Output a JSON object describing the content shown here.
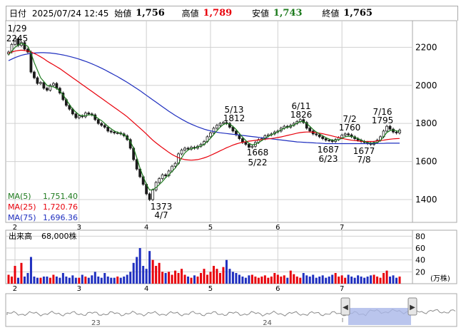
{
  "header": {
    "date_label": "日付",
    "datetime": "2025/07/24 12:45",
    "open_label": "始値",
    "open_value": "1,756",
    "high_label": "高値",
    "high_value": "1,789",
    "low_label": "安値",
    "low_value": "1,743",
    "close_label": "終値",
    "close_value": "1,765"
  },
  "colors": {
    "up": "#e8000b",
    "down": "#1f2fbf",
    "ma5": "#1d7a1d",
    "ma25": "#e8000b",
    "ma75": "#1f2fbf",
    "grid": "#d0d0d0",
    "border": "#a9a9a9",
    "navigator_fill": "#a9b6e8"
  },
  "chart_data": [
    {
      "type": "candlestick",
      "price_axis": {
        "ticks": [
          1400,
          1600,
          1800,
          2000,
          2200
        ]
      },
      "month_labels": [
        {
          "label": "2",
          "index": 2
        },
        {
          "label": "3",
          "index": 22
        },
        {
          "label": "4",
          "index": 43
        },
        {
          "label": "5",
          "index": 63
        },
        {
          "label": "6",
          "index": 84
        },
        {
          "label": "7",
          "index": 104
        }
      ],
      "legend": [
        {
          "name": "MA(5)",
          "value": "1,751.40"
        },
        {
          "name": "MA(25)",
          "value": "1,720.76"
        },
        {
          "name": "MA(75)",
          "value": "1,696.36"
        }
      ],
      "annotations": [
        {
          "date": "1/29",
          "price": "2245"
        },
        {
          "date": "4/7",
          "price": "1373"
        },
        {
          "date": "5/13",
          "price": "1812"
        },
        {
          "date": "5/22",
          "price": "1668"
        },
        {
          "date": "6/11",
          "price": "1826"
        },
        {
          "date": "6/23",
          "price": "1687"
        },
        {
          "date": "7/2",
          "price": "1760"
        },
        {
          "date": "7/8",
          "price": "1677"
        },
        {
          "date": "7/16",
          "price": "1795"
        }
      ],
      "close": [
        2175,
        2215,
        2245,
        2210,
        2225,
        2190,
        2175,
        2070,
        2040,
        2010,
        2015,
        1985,
        1975,
        2000,
        2010,
        1985,
        1960,
        1925,
        1895,
        1875,
        1850,
        1830,
        1840,
        1835,
        1855,
        1850,
        1845,
        1820,
        1800,
        1790,
        1780,
        1760,
        1755,
        1750,
        1750,
        1745,
        1735,
        1715,
        1670,
        1610,
        1560,
        1520,
        1480,
        1430,
        1400,
        1450,
        1490,
        1510,
        1530,
        1525,
        1550,
        1575,
        1590,
        1640,
        1660,
        1670,
        1665,
        1675,
        1670,
        1680,
        1690,
        1705,
        1730,
        1750,
        1775,
        1790,
        1800,
        1805,
        1800,
        1780,
        1760,
        1740,
        1720,
        1700,
        1690,
        1675,
        1680,
        1700,
        1715,
        1720,
        1735,
        1740,
        1745,
        1755,
        1760,
        1775,
        1785,
        1780,
        1790,
        1800,
        1810,
        1820,
        1805,
        1775,
        1760,
        1745,
        1740,
        1730,
        1720,
        1712,
        1710,
        1705,
        1715,
        1725,
        1738,
        1745,
        1740,
        1730,
        1720,
        1712,
        1705,
        1700,
        1695,
        1690,
        1700,
        1712,
        1730,
        1760,
        1785,
        1770,
        1755,
        1750,
        1765
      ],
      "ma5": [
        2160,
        2180,
        2200,
        2212,
        2220,
        2215,
        2205,
        2170,
        2120,
        2080,
        2040,
        2020,
        2000,
        1995,
        1992,
        1985,
        1970,
        1950,
        1925,
        1900,
        1875,
        1860,
        1845,
        1840,
        1842,
        1845,
        1845,
        1838,
        1825,
        1815,
        1800,
        1785,
        1772,
        1760,
        1754,
        1748,
        1740,
        1728,
        1705,
        1670,
        1620,
        1565,
        1520,
        1480,
        1450,
        1452,
        1462,
        1478,
        1495,
        1515,
        1530,
        1548,
        1565,
        1590,
        1620,
        1645,
        1660,
        1668,
        1670,
        1676,
        1682,
        1690,
        1705,
        1722,
        1742,
        1762,
        1780,
        1795,
        1800,
        1796,
        1784,
        1768,
        1748,
        1728,
        1710,
        1695,
        1688,
        1690,
        1700,
        1710,
        1722,
        1732,
        1740,
        1748,
        1756,
        1766,
        1775,
        1780,
        1785,
        1792,
        1802,
        1810,
        1810,
        1800,
        1785,
        1768,
        1755,
        1745,
        1735,
        1725,
        1718,
        1712,
        1712,
        1715,
        1722,
        1730,
        1733,
        1732,
        1728,
        1720,
        1712,
        1705,
        1700,
        1697,
        1697,
        1700,
        1710,
        1730,
        1752,
        1762,
        1766,
        1761,
        1758
      ],
      "ma25": [
        2170,
        2175,
        2180,
        2183,
        2185,
        2183,
        2180,
        2175,
        2168,
        2160,
        2150,
        2140,
        2128,
        2118,
        2108,
        2098,
        2088,
        2076,
        2064,
        2052,
        2040,
        2028,
        2016,
        2004,
        1992,
        1980,
        1968,
        1956,
        1944,
        1932,
        1920,
        1908,
        1896,
        1884,
        1872,
        1860,
        1848,
        1835,
        1820,
        1805,
        1790,
        1775,
        1760,
        1745,
        1728,
        1712,
        1698,
        1685,
        1672,
        1660,
        1648,
        1637,
        1628,
        1620,
        1614,
        1610,
        1608,
        1607,
        1608,
        1610,
        1614,
        1619,
        1625,
        1632,
        1640,
        1648,
        1656,
        1664,
        1672,
        1679,
        1686,
        1692,
        1697,
        1701,
        1704,
        1707,
        1709,
        1711,
        1713,
        1715,
        1717,
        1719,
        1721,
        1723,
        1726,
        1729,
        1733,
        1737,
        1741,
        1745,
        1749,
        1752,
        1754,
        1755,
        1755,
        1754,
        1752,
        1749,
        1746,
        1742,
        1738,
        1734,
        1730,
        1726,
        1722,
        1718,
        1715,
        1712,
        1710,
        1708,
        1706,
        1705,
        1705,
        1705,
        1706,
        1708,
        1710,
        1712,
        1715,
        1717,
        1719,
        1720,
        1721
      ],
      "ma75": [
        2130,
        2138,
        2146,
        2152,
        2158,
        2162,
        2165,
        2168,
        2170,
        2171,
        2172,
        2172,
        2171,
        2170,
        2168,
        2166,
        2163,
        2160,
        2156,
        2152,
        2148,
        2143,
        2138,
        2132,
        2126,
        2120,
        2113,
        2106,
        2098,
        2090,
        2082,
        2073,
        2064,
        2055,
        2046,
        2036,
        2026,
        2016,
        2005,
        1994,
        1983,
        1972,
        1960,
        1948,
        1936,
        1924,
        1912,
        1900,
        1888,
        1876,
        1864,
        1853,
        1842,
        1832,
        1822,
        1813,
        1804,
        1796,
        1789,
        1782,
        1776,
        1770,
        1765,
        1761,
        1757,
        1754,
        1751,
        1749,
        1747,
        1745,
        1743,
        1741,
        1739,
        1737,
        1735,
        1733,
        1731,
        1729,
        1727,
        1725,
        1723,
        1721,
        1719,
        1717,
        1715,
        1713,
        1711,
        1709,
        1707,
        1705,
        1703,
        1702,
        1701,
        1700,
        1699,
        1698,
        1697,
        1696,
        1695,
        1694,
        1694,
        1694,
        1694,
        1694,
        1694,
        1694,
        1694,
        1694,
        1694,
        1694,
        1694,
        1694,
        1694,
        1694,
        1694,
        1695,
        1695,
        1695,
        1696,
        1696,
        1696,
        1696,
        1696
      ]
    },
    {
      "type": "bar",
      "title": "出来高",
      "unit_label": "(万株)",
      "current_value_label": "68,000株",
      "y_ticks": [
        20,
        40,
        60,
        80
      ],
      "values": [
        15,
        12,
        30,
        10,
        35,
        12,
        18,
        45,
        12,
        10,
        10,
        12,
        12,
        10,
        15,
        12,
        10,
        18,
        12,
        10,
        14,
        10,
        10,
        15,
        12,
        10,
        14,
        20,
        12,
        10,
        18,
        12,
        10,
        10,
        12,
        10,
        12,
        15,
        20,
        35,
        45,
        60,
        30,
        25,
        55,
        40,
        30,
        35,
        20,
        18,
        20,
        15,
        22,
        18,
        25,
        15,
        12,
        10,
        14,
        12,
        18,
        25,
        15,
        20,
        30,
        25,
        18,
        28,
        40,
        25,
        20,
        18,
        15,
        12,
        10,
        14,
        15,
        12,
        10,
        12,
        14,
        10,
        12,
        18,
        15,
        12,
        14,
        10,
        22,
        16,
        12,
        10,
        18,
        14,
        12,
        15,
        10,
        12,
        14,
        10,
        12,
        15,
        18,
        12,
        14,
        10,
        15,
        12,
        10,
        14,
        12,
        10,
        12,
        14,
        15,
        12,
        10,
        18,
        22,
        12,
        14,
        10,
        12
      ],
      "up": [
        1,
        1,
        1,
        0,
        1,
        0,
        0,
        0,
        0,
        0,
        1,
        0,
        0,
        1,
        1,
        0,
        0,
        0,
        0,
        0,
        0,
        0,
        1,
        0,
        1,
        0,
        0,
        0,
        0,
        0,
        0,
        0,
        0,
        0,
        1,
        0,
        0,
        0,
        0,
        0,
        0,
        0,
        0,
        0,
        0,
        1,
        1,
        1,
        1,
        0,
        1,
        1,
        1,
        1,
        1,
        1,
        0,
        1,
        0,
        1,
        1,
        1,
        1,
        1,
        1,
        1,
        1,
        1,
        0,
        0,
        0,
        0,
        0,
        0,
        0,
        0,
        1,
        1,
        1,
        1,
        1,
        1,
        1,
        1,
        1,
        1,
        1,
        0,
        1,
        1,
        1,
        1,
        0,
        0,
        0,
        0,
        0,
        0,
        0,
        0,
        0,
        0,
        1,
        1,
        1,
        1,
        0,
        0,
        0,
        0,
        0,
        0,
        0,
        0,
        1,
        1,
        1,
        1,
        1,
        0,
        0,
        0,
        1
      ]
    },
    {
      "type": "area",
      "navigator_labels": [
        {
          "label": "23",
          "pos": 0.2
        },
        {
          "label": "24",
          "pos": 0.58
        }
      ]
    }
  ]
}
